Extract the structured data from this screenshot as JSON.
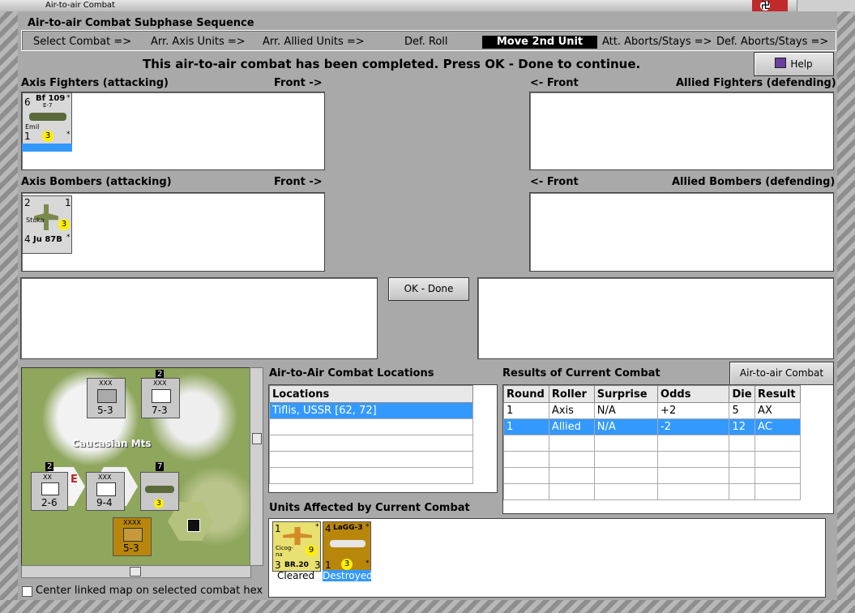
{
  "window": {
    "title": "Air-to-air Combat"
  },
  "sequence": {
    "group_label": "Air-to-air Combat Subphase Sequence",
    "steps": [
      "Select Combat =>",
      "Arr. Axis Units =>",
      "Arr. Allied Units =>",
      "Def. Roll",
      "Move 2nd Unit",
      "Att. Aborts/Stays =>",
      "Def. Aborts/Stays =>"
    ],
    "active_step": "Move 2nd Unit"
  },
  "message": "This air-to-air combat has been completed.  Press OK - Done to continue.",
  "help_label": "Help",
  "panels": {
    "axis_fighters": {
      "label": "Axis Fighters (attacking)",
      "front": "Front ->"
    },
    "allied_fighters": {
      "label": "Allied Fighters (defending)",
      "front": "<- Front"
    },
    "axis_bombers": {
      "label": "Axis Bombers (attacking)",
      "front": "Front ->"
    },
    "allied_bombers": {
      "label": "Allied Bombers (defending)",
      "front": "<- Front"
    }
  },
  "counters": {
    "bf109": {
      "left": "6",
      "name": "Bf 109",
      "sub": "E-7",
      "nick": "Emil",
      "bottom_left": "1",
      "range": "3",
      "star": "*"
    },
    "ju87": {
      "top_left": "2",
      "top_right": "1",
      "nick": "Stuka",
      "range": "3",
      "bottom_left": "4",
      "name": "Ju 87B",
      "star": "*"
    }
  },
  "ok_button": "OK - Done",
  "map": {
    "label_mountains": "Caucasian Mts",
    "units": [
      {
        "type": "XXX",
        "value": "5-3"
      },
      {
        "type": "XXX",
        "value": "7-3"
      },
      {
        "type": "XX",
        "value": "2-6"
      },
      {
        "type": "XXX",
        "value": "9-4"
      },
      {
        "type": "XXXX",
        "value": "5-3"
      }
    ],
    "stack_counts": [
      "2",
      "2",
      "7"
    ],
    "center_checkbox_label": "Center linked map on selected combat hex"
  },
  "locations": {
    "title": "Air-to-Air Combat Locations",
    "header": "Locations",
    "rows": [
      "Tiflis, USSR [62, 72]"
    ]
  },
  "results": {
    "title": "Results of Current Combat",
    "chart_button": "Air-to-air Combat Chart",
    "headers": [
      "Round",
      "Roller",
      "Surprise",
      "Odds",
      "Die",
      "Result"
    ],
    "rows": [
      [
        "1",
        "Axis",
        "N/A",
        "+2",
        "5",
        "AX"
      ],
      [
        "1",
        "Allied",
        "N/A",
        "-2",
        "12",
        "AC"
      ]
    ]
  },
  "affected": {
    "title": "Units Affected by Current Combat",
    "units": [
      {
        "top_left": "1",
        "star": "*",
        "nick": "Cicog-na",
        "range": "9",
        "bottom_left": "3",
        "name": "BR.20",
        "bottom_right": "3",
        "status": "Cleared"
      },
      {
        "top_left": "4",
        "name": "LaGG-3",
        "star": "*",
        "bottom_left": "1",
        "range": "3",
        "status": "Destroyed"
      }
    ]
  }
}
